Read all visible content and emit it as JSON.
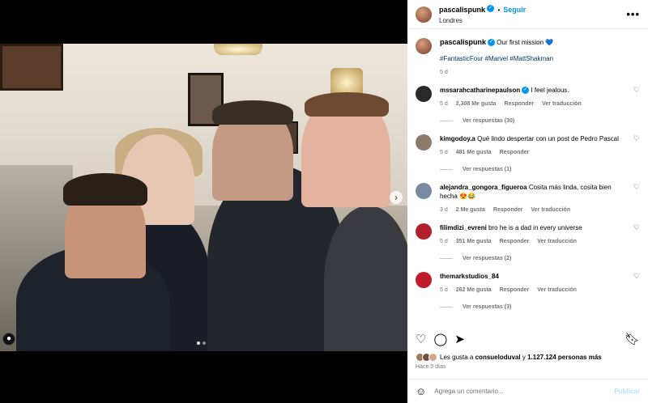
{
  "post": {
    "username": "pascalispunk",
    "follow_label": "Seguir",
    "location": "Londres",
    "more_label": "•••",
    "caption": "Our first mission 💙",
    "hashtags": "#FantasticFour #Marvel #MattShakman",
    "caption_age": "5 d"
  },
  "comments": [
    {
      "user": "mssarahcatharinepaulson",
      "verified": true,
      "text": "I feel jealous.",
      "age": "5 d",
      "likes": "2,308 Me gusta",
      "reply": "Responder",
      "translate": "Ver traducción",
      "replies": "Ver respuestas (30)",
      "avatar_color": "#2a2a2a"
    },
    {
      "user": "kimgodoy.a",
      "verified": false,
      "text": "Qué lindo despertar con un post de Pedro Pascal",
      "age": "5 d",
      "likes": "481 Me gusta",
      "reply": "Responder",
      "translate": "",
      "replies": "Ver respuestas (1)",
      "avatar_color": "#8c7a6a"
    },
    {
      "user": "alejandra_gongora_figueroa",
      "verified": false,
      "text": "Cosita más linda, cosita bien hecha 😍😂",
      "age": "3 d",
      "likes": "2 Me gusta",
      "reply": "Responder",
      "translate": "Ver traducción",
      "replies": "",
      "avatar_color": "#7a8aa0"
    },
    {
      "user": "filimdizi_evreni",
      "verified": false,
      "text": "bro he is a dad in every universe",
      "age": "5 d",
      "likes": "351 Me gusta",
      "reply": "Responder",
      "translate": "Ver traducción",
      "replies": "Ver respuestas (2)",
      "avatar_color": "#b01e2a"
    },
    {
      "user": "themarkstudios_84",
      "verified": false,
      "text": "",
      "age": "5 d",
      "likes": "262 Me gusta",
      "reply": "Responder",
      "translate": "Ver traducción",
      "replies": "Ver respuestas (3)",
      "avatar_color": "#c01a2c"
    }
  ],
  "engagement": {
    "liked_by_prefix": "Les gusta a",
    "liked_by_user": "consueloduval",
    "and": "y",
    "others": "1.127.124 personas más",
    "time_ago": "Hace 5 días"
  },
  "compose": {
    "placeholder": "Agrega un comentario...",
    "post_label": "Publicar"
  },
  "media": {
    "next_label": "›",
    "carousel_pages": 2,
    "carousel_current": 1
  }
}
